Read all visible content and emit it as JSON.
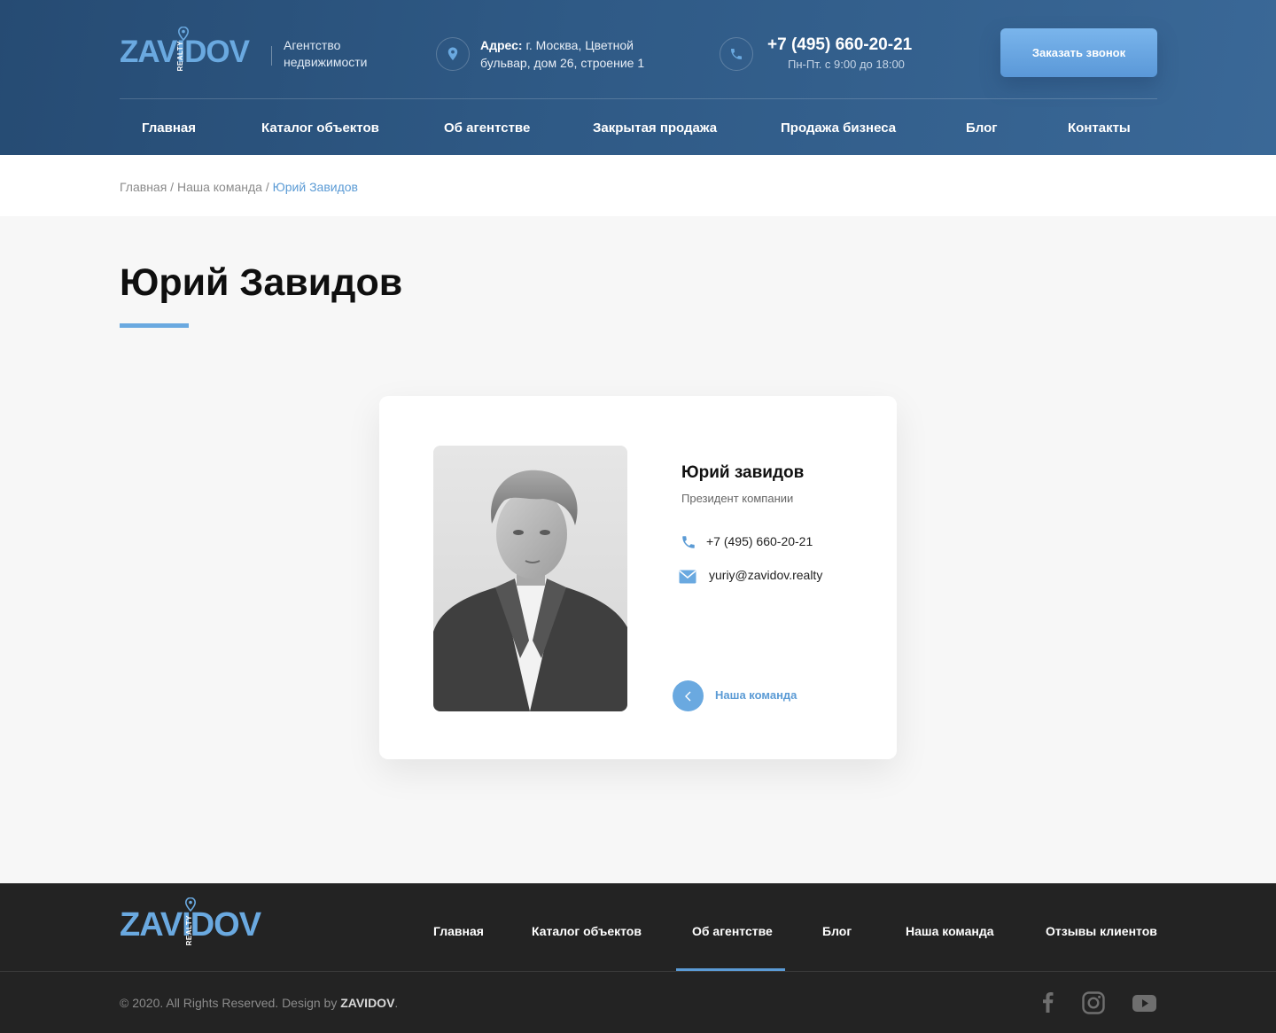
{
  "header": {
    "logo_text": "ZAVIDOV",
    "logo_sub": "REALTY",
    "tagline": "Агентство недвижимости",
    "address_label": "Адрес:",
    "address_text": " г. Москва, Цветной бульвар, дом 26, строение 1",
    "phone": "+7 (495) 660-20-21",
    "hours": "Пн-Пт. с  9:00 до 18:00",
    "call_button": "Заказать звонок"
  },
  "nav": [
    "Главная",
    "Каталог объектов",
    "Об агентстве",
    "Закрытая продажа",
    "Продажа бизнеса",
    "Блог",
    "Контакты"
  ],
  "breadcrumb": {
    "items": [
      "Главная",
      "Наша команда"
    ],
    "separator": " / ",
    "current": "Юрий Завидов"
  },
  "page_title": "Юрий Завидов",
  "card": {
    "name": "Юрий завидов",
    "role": "Президент компании",
    "phone": "+7 (495) 660-20-21",
    "email": "yuriy@zavidov.realty",
    "back_label": "Наша команда"
  },
  "footer": {
    "logo_text": "ZAVIDOV",
    "logo_sub": "REALTY",
    "nav": [
      "Главная",
      "Каталог объектов",
      "Об агентстве",
      "Блог",
      "Наша команда",
      "Отзывы клиентов"
    ],
    "active_nav": "Об агентстве",
    "copyright_prefix": "© 2020. All Rights Reserved. Design by ",
    "copyright_brand": "ZAVIDOV",
    "copyright_suffix": ".",
    "social": [
      "facebook-icon",
      "instagram-icon",
      "youtube-icon"
    ]
  },
  "colors": {
    "accent": "#6aa9e0",
    "header_bg": "#2f5a86",
    "footer_bg": "#232323",
    "page_bg": "#f7f7f7"
  }
}
